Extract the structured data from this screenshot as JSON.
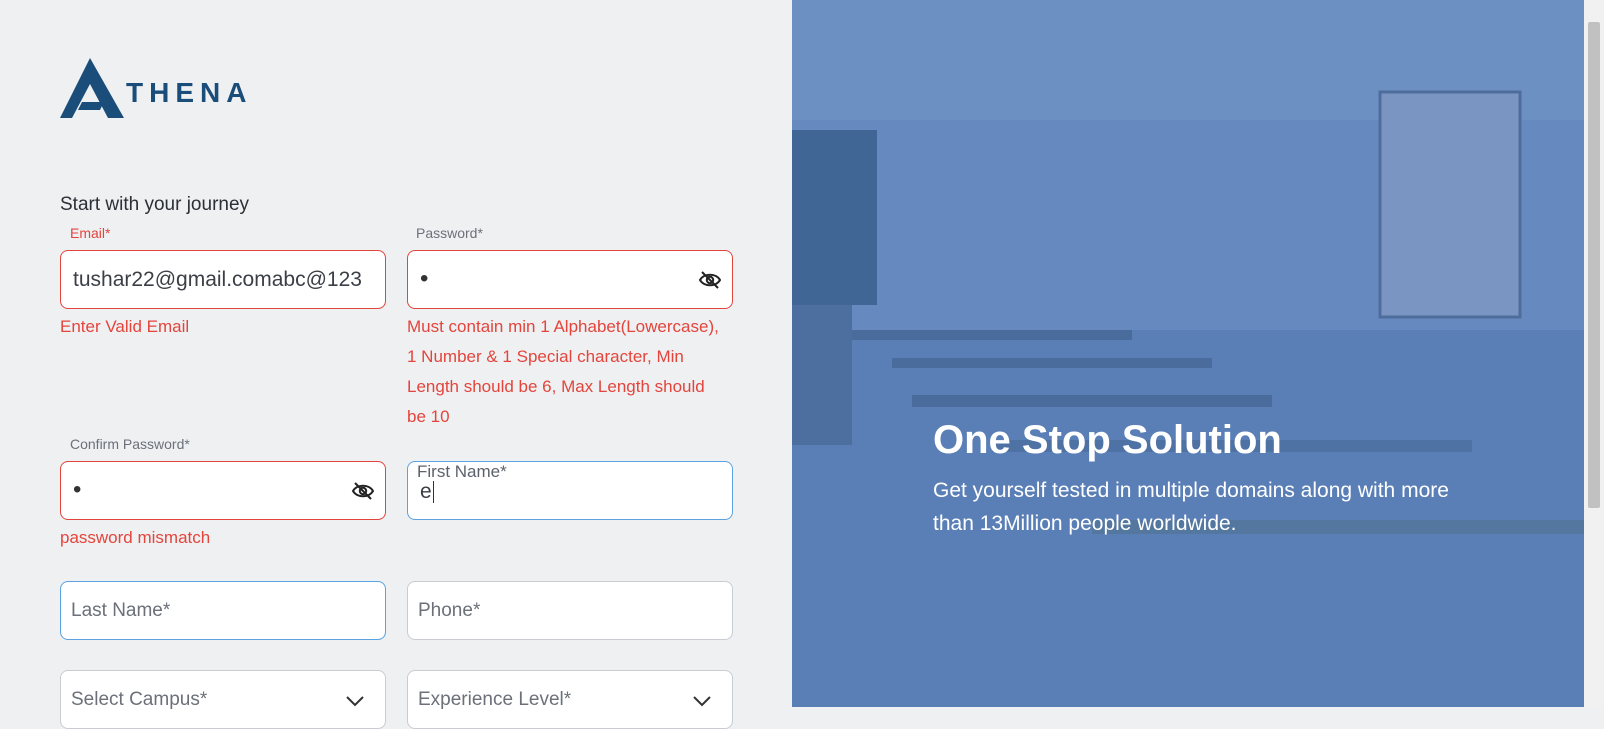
{
  "brand": {
    "name": "THENA"
  },
  "form": {
    "subtitle": "Start with your journey",
    "email": {
      "label": "Email*",
      "value": "tushar22@gmail.comabc@123",
      "error": "Enter Valid Email"
    },
    "password": {
      "label": "Password*",
      "value": "•",
      "error_lines": [
        "Must contain min 1 Alphabet(Lowercase),",
        "1 Number & 1 Special character, Min",
        "Length should be 6, Max Length should",
        "be 10"
      ]
    },
    "confirm_password": {
      "label": "Confirm Password*",
      "value": "•",
      "error": "password mismatch"
    },
    "first_name": {
      "label": "First Name*",
      "value": "e"
    },
    "last_name": {
      "placeholder": "Last Name*"
    },
    "phone": {
      "placeholder": "Phone*"
    },
    "campus": {
      "placeholder": "Select Campus*"
    },
    "experience": {
      "placeholder": "Experience Level*"
    }
  },
  "hero": {
    "title": "One Stop Solution",
    "text": "Get yourself tested in multiple domains along with more than 13Million people worldwide."
  },
  "colors": {
    "brand": "#1b4d7a",
    "error": "#e3453c",
    "focus": "#5aa2e0"
  },
  "icons": {
    "eye": "eye-off-icon",
    "chevron": "chevron-down-icon"
  }
}
